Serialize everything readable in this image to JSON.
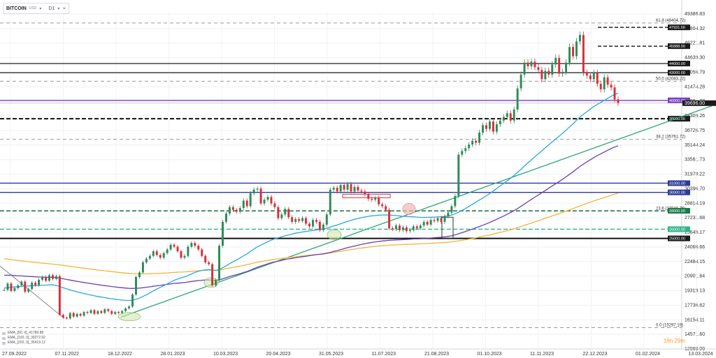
{
  "header": {
    "symbol": "BITCOIN",
    "currency": "USD",
    "timeframe": "D1",
    "dropdown_icon": "chevron-down-icon",
    "close_icon": "close-icon"
  },
  "timer": "16h 29m",
  "indicators": [
    "EMA_[50, 0]_41789.88",
    "EMA_[100, 0]_39272.92",
    "EMA_[200, 0]_35419.12"
  ],
  "colors": {
    "up_candle": "#2e8b57",
    "down_candle": "#d6303a",
    "ema50": "#29a8e0",
    "ema100": "#6a3fb0",
    "ema200": "#f2b632",
    "trendline": "#2aa876",
    "highlight_ellipse": "#cfe8b0"
  },
  "chart_data": {
    "type": "candlestick",
    "title": "",
    "y_axis_ticks": [
      "49386.83",
      "47804.32",
      "46221.81",
      "44639.30",
      "43056.79",
      "41474.28",
      "39891.77",
      "38309.26",
      "36726.75",
      "35144.24",
      "33561.73",
      "31979.22",
      "30396.70",
      "28814.19",
      "27231.68",
      "25649.17",
      "24066.66",
      "22484.15",
      "20901.64",
      "19319.13",
      "17736.62",
      "16154.11",
      "14571.60",
      "12989.09"
    ],
    "x_axis_ticks": [
      "27.09.2022",
      "07.11.2022",
      "18.12.2022",
      "28.01.2023",
      "10.03.2023",
      "20.04.2023",
      "31.05.2023",
      "11.07.2023",
      "21.08.2023",
      "01.10.2023",
      "11.11.2023",
      "22.12.2023",
      "01.02.2024",
      "13.03.2024"
    ],
    "ylim": [
      12989.09,
      49386.83
    ],
    "current_price": "39696.00",
    "horizontal_levels": [
      {
        "value": 44000,
        "label": "44000.00",
        "style": "solid",
        "color": "#333333"
      },
      {
        "value": 43000,
        "label": "43000.00",
        "style": "solid",
        "color": "#333333"
      },
      {
        "value": 40000,
        "label": "40000.00",
        "style": "solid",
        "color": "#7b3fc6"
      },
      {
        "value": 38000,
        "label": "38000.00",
        "style": "dashed",
        "color": "#111111"
      },
      {
        "value": 31000,
        "label": "31000.00",
        "style": "solid",
        "color": "#2b3a9a"
      },
      {
        "value": 30000,
        "label": "30000.00",
        "style": "solid",
        "color": "#2b3a9a"
      },
      {
        "value": 28000,
        "label": "28000.00",
        "style": "dashed",
        "color": "#1a7a4a"
      },
      {
        "value": 26000,
        "label": "26000.00",
        "style": "dashed",
        "color": "#2fb58a"
      },
      {
        "value": 25000,
        "label": "25000.00",
        "style": "solid",
        "color": "#111111"
      },
      {
        "value": 47931,
        "label": "47931.00",
        "style": "dashed",
        "color": "#111111"
      },
      {
        "value": 45888,
        "label": "45888.00",
        "style": "dashed",
        "color": "#111111"
      }
    ],
    "fibonacci": [
      {
        "label": "61.8 (48404.72)",
        "value": 48404.72
      },
      {
        "label": "50.0 (42083.22)",
        "value": 42083.22
      },
      {
        "label": "38.2 (35761.72)",
        "value": 35761.72
      },
      {
        "label": "23.6 (27946.76)",
        "value": 27946.76
      },
      {
        "label": "0.0 (15297.19)",
        "value": 15297.19
      }
    ],
    "candles_close": [
      19400,
      20100,
      19300,
      19600,
      19900,
      20300,
      19200,
      19500,
      20200,
      19900,
      20500,
      20800,
      20400,
      21000,
      20600,
      20900,
      16700,
      16400,
      16300,
      16900,
      16500,
      16800,
      16600,
      17000,
      16900,
      17200,
      16800,
      17100,
      16900,
      17300,
      17100,
      16800,
      17000,
      16900,
      17100,
      17400,
      17600,
      18900,
      20800,
      21300,
      22400,
      22800,
      23100,
      23600,
      23200,
      22900,
      23400,
      23800,
      24300,
      24100,
      23600,
      22900,
      23100,
      24100,
      24500,
      24200,
      23800,
      23100,
      22400,
      22200,
      19900,
      20500,
      24200,
      26800,
      27700,
      28400,
      28100,
      27900,
      28300,
      29100,
      28500,
      29900,
      30300,
      30400,
      28800,
      29200,
      29500,
      28800,
      28400,
      27200,
      27600,
      28200,
      27300,
      26800,
      27100,
      26900,
      27200,
      26600,
      26300,
      27000,
      26800,
      25900,
      26500,
      27600,
      30300,
      30500,
      30100,
      30800,
      30300,
      30900,
      30100,
      30600,
      30200,
      30100,
      29800,
      29300,
      29200,
      29400,
      28700,
      28500,
      28100,
      26100,
      26000,
      26400,
      25900,
      26200,
      25800,
      25900,
      26300,
      26100,
      26400,
      26800,
      26500,
      27000,
      26900,
      27200,
      26800,
      27400,
      27800,
      28500,
      29600,
      34100,
      34500,
      34800,
      35200,
      35600,
      35400,
      36500,
      37300,
      36900,
      37700,
      36600,
      37400,
      37800,
      38200,
      38600,
      37800,
      39000,
      41300,
      42800,
      44100,
      43700,
      44200,
      43600,
      43300,
      42300,
      43200,
      42800,
      43900,
      44600,
      42900,
      43100,
      44100,
      45800,
      44800,
      46400,
      47100,
      43000,
      42700,
      42300,
      43000,
      41800,
      41200,
      42500,
      41700,
      41400,
      40100,
      39700
    ],
    "ema50": [
      19600,
      19650,
      19700,
      19720,
      19750,
      19780,
      19810,
      19830,
      19860,
      19880,
      19900,
      19920,
      19930,
      19950,
      19950,
      19900,
      19760,
      19640,
      19520,
      19400,
      19300,
      19190,
      19100,
      19010,
      18920,
      18840,
      18760,
      18690,
      18620,
      18560,
      18500,
      18440,
      18390,
      18340,
      18300,
      18270,
      18260,
      18290,
      18390,
      18510,
      18690,
      18880,
      19080,
      19300,
      19500,
      19680,
      19870,
      20060,
      20260,
      20440,
      20590,
      20700,
      20820,
      20970,
      21140,
      21300,
      21430,
      21520,
      21570,
      21610,
      21550,
      21510,
      21620,
      21810,
      22020,
      22250,
      22470,
      22660,
      22870,
      23110,
      23320,
      23580,
      23840,
      24080,
      24270,
      24450,
      24640,
      24810,
      24960,
      25060,
      25170,
      25290,
      25380,
      25470,
      25560,
      25620,
      25700,
      25760,
      25810,
      25860,
      25910,
      25960,
      26020,
      26110,
      26230,
      26340,
      26460,
      26590,
      26720,
      26850,
      26960,
      27070,
      27160,
      27250,
      27330,
      27400,
      27450,
      27480,
      27520,
      27540,
      27550,
      27530,
      27510,
      27480,
      27440,
      27400,
      27380,
      27360,
      27340,
      27310,
      27290,
      27280,
      27290,
      27300,
      27310,
      27330,
      27360,
      27400,
      27450,
      27530,
      27680,
      27850,
      28040,
      28250,
      28480,
      28700,
      28930,
      29170,
      29380,
      29630,
      29880,
      30150,
      30420,
      30700,
      30970,
      31250,
      31540,
      31840,
      32170,
      32510,
      32860,
      33200,
      33540,
      33870,
      34190,
      34510,
      34840,
      35160,
      35490,
      35800,
      36110,
      36420,
      36760,
      37120,
      37440,
      37830,
      38180,
      38480,
      38770,
      39050,
      39330,
      39560,
      39770,
      40000,
      40220,
      40440,
      40620,
      40780
    ],
    "ema100": [
      21000,
      21000,
      21000,
      20970,
      20940,
      20920,
      20890,
      20870,
      20850,
      20830,
      20800,
      20790,
      20780,
      20770,
      20760,
      20750,
      20680,
      20610,
      20540,
      20470,
      20400,
      20340,
      20270,
      20210,
      20150,
      20090,
      20030,
      19980,
      19920,
      19870,
      19820,
      19770,
      19730,
      19680,
      19640,
      19600,
      19570,
      19560,
      19580,
      19600,
      19640,
      19690,
      19740,
      19800,
      19850,
      19890,
      19950,
      20000,
      20050,
      20110,
      20140,
      20170,
      20200,
      20260,
      20320,
      20370,
      20420,
      20450,
      20480,
      20490,
      20460,
      20440,
      20490,
      20600,
      20720,
      20850,
      20960,
      21060,
      21160,
      21290,
      21400,
      21550,
      21720,
      21870,
      21990,
      22110,
      22240,
      22360,
      22450,
      22530,
      22610,
      22700,
      22770,
      22830,
      22890,
      22950,
      23010,
      23060,
      23120,
      23180,
      23230,
      23270,
      23320,
      23390,
      23470,
      23580,
      23670,
      23780,
      23880,
      23990,
      24080,
      24170,
      24260,
      24340,
      24420,
      24490,
      24560,
      24620,
      24670,
      24720,
      24760,
      24790,
      24810,
      24830,
      24850,
      24870,
      24890,
      24910,
      24940,
      24950,
      24960,
      24980,
      25000,
      25040,
      25070,
      25100,
      25130,
      25170,
      25220,
      25280,
      25390,
      25500,
      25620,
      25750,
      25880,
      26010,
      26150,
      26290,
      26430,
      26580,
      26740,
      26910,
      27070,
      27250,
      27430,
      27620,
      27810,
      28020,
      28240,
      28480,
      28740,
      28990,
      29240,
      29480,
      29720,
      29960,
      30210,
      30450,
      30700,
      30940,
      31180,
      31430,
      31690,
      31970,
      32230,
      32530,
      32820,
      33070,
      33310,
      33550,
      33790,
      34000,
      34190,
      34390,
      34580,
      34760,
      34930,
      35070
    ],
    "ema200": [
      22800,
      22750,
      22700,
      22650,
      22600,
      22560,
      22510,
      22470,
      22430,
      22390,
      22350,
      22310,
      22280,
      22240,
      22200,
      22170,
      22120,
      22070,
      22010,
      21960,
      21910,
      21860,
      21810,
      21760,
      21710,
      21660,
      21610,
      21560,
      21520,
      21480,
      21430,
      21390,
      21350,
      21310,
      21270,
      21230,
      21190,
      21170,
      21150,
      21140,
      21140,
      21150,
      21160,
      21180,
      21190,
      21210,
      21230,
      21250,
      21280,
      21300,
      21320,
      21340,
      21360,
      21390,
      21420,
      21450,
      21480,
      21510,
      21530,
      21550,
      21550,
      21540,
      21570,
      21640,
      21710,
      21780,
      21850,
      21920,
      21990,
      22060,
      22140,
      22230,
      22320,
      22410,
      22480,
      22540,
      22610,
      22670,
      22720,
      22770,
      22820,
      22870,
      22920,
      22960,
      23000,
      23050,
      23090,
      23130,
      23170,
      23210,
      23250,
      23280,
      23320,
      23360,
      23410,
      23480,
      23540,
      23600,
      23660,
      23730,
      23790,
      23840,
      23900,
      23950,
      24000,
      24050,
      24100,
      24140,
      24180,
      24210,
      24240,
      24260,
      24280,
      24300,
      24320,
      24330,
      24350,
      24360,
      24380,
      24390,
      24410,
      24430,
      24450,
      24470,
      24490,
      24510,
      24530,
      24560,
      24590,
      24620,
      24680,
      24730,
      24790,
      24850,
      24920,
      24990,
      25060,
      25140,
      25220,
      25300,
      25380,
      25470,
      25560,
      25650,
      25740,
      25840,
      25940,
      26050,
      26170,
      26290,
      26420,
      26550,
      26670,
      26800,
      26920,
      27050,
      27180,
      27310,
      27440,
      27570,
      27700,
      27820,
      27960,
      28110,
      28240,
      28380,
      28530,
      28660,
      28800,
      28930,
      29070,
      29190,
      29310,
      29440,
      29560,
      29680,
      29800,
      29910
    ]
  }
}
